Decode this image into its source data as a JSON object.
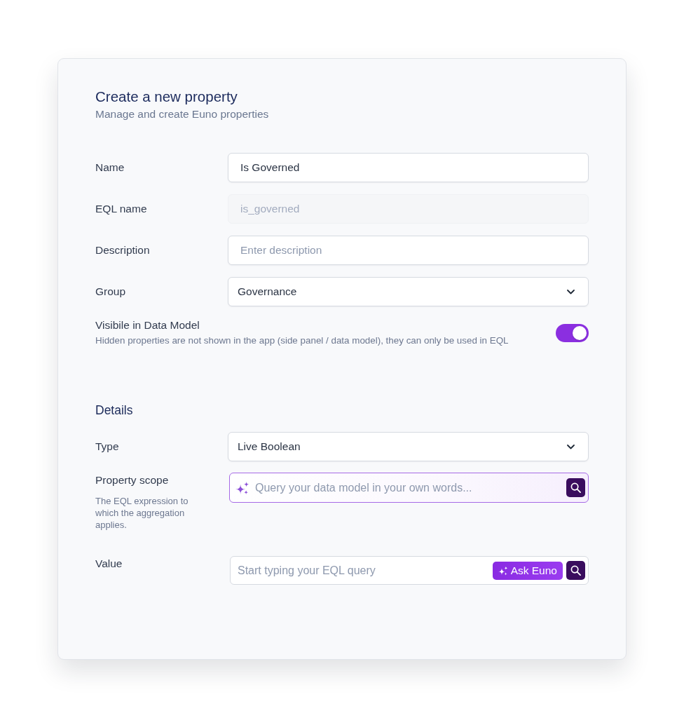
{
  "form": {
    "title": "Create a new property",
    "subtitle": "Manage and create Euno properties"
  },
  "fields": [
    {
      "kind": "text",
      "label": "Name",
      "value": "Is Governed",
      "disabled": false
    },
    {
      "kind": "text",
      "label": "EQL name",
      "value": "is_governed",
      "disabled": true
    },
    {
      "kind": "text",
      "label": "Description",
      "placeholder": "Enter description",
      "disabled": false
    },
    {
      "kind": "select",
      "label": "Group",
      "value": "Governance",
      "disabled": false
    }
  ],
  "visibility": {
    "label": "Visibile in Data Model",
    "hint": "Hidden properties are not shown in the app (side panel / data model), they can only be used in EQL",
    "on": true
  },
  "details": {
    "title": "Details",
    "fields": [
      {
        "kind": "select",
        "label": "Type",
        "value": "Live Boolean",
        "disabled": false
      },
      {
        "kind": "ai-query",
        "label": "Property scope",
        "hint": "The EQL expression to which the aggregation applies.",
        "placeholder": "Query your data model in your own words...",
        "disabled": false
      },
      {
        "kind": "eql-query",
        "label": "Value",
        "placeholder": "Start typing your EQL query",
        "button": "Ask Euno",
        "disabled": false
      }
    ]
  }
}
